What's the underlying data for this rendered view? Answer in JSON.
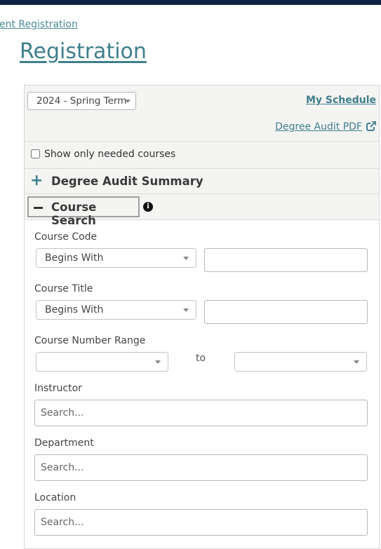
{
  "breadcrumb": "ent Registration",
  "page_title": "Registration",
  "header": {
    "term_select": "2024 - Spring Term",
    "my_schedule": "My Schedule",
    "degree_audit_pdf": "Degree Audit PDF"
  },
  "filters": {
    "show_needed_label": "Show only needed courses",
    "show_needed_checked": false
  },
  "sections": {
    "audit_summary": "Degree Audit Summary",
    "course_search": "Course Search"
  },
  "form": {
    "course_code_label": "Course Code",
    "course_code_op": "Begins With",
    "course_code_value": "",
    "course_title_label": "Course Title",
    "course_title_op": "Begins With",
    "course_title_value": "",
    "number_range_label": "Course Number Range",
    "range_from": "",
    "range_to_word": "to",
    "range_to": "",
    "instructor_label": "Instructor",
    "instructor_placeholder": "Search...",
    "department_label": "Department",
    "department_placeholder": "Search...",
    "location_label": "Location",
    "location_placeholder": "Search..."
  },
  "icons": {
    "expand": "plus-icon",
    "collapse": "minus-icon",
    "info": "info-icon",
    "external": "external-link-icon",
    "dropdown": "chevron-down-icon"
  },
  "colors": {
    "accent": "#3f7f8c",
    "topbar": "#0f2442",
    "panel_bg": "#f4f4f2"
  }
}
